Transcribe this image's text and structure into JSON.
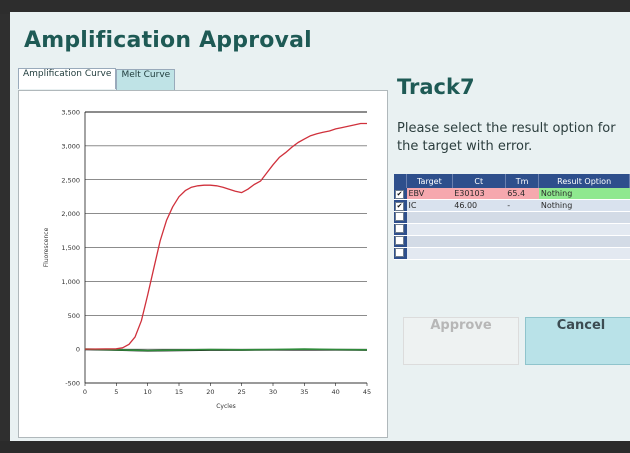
{
  "dialog": {
    "title": "Amplification Approval",
    "tabs": [
      {
        "label": "Amplification Curve",
        "active": true
      },
      {
        "label": "Melt Curve",
        "active": false
      }
    ],
    "track": "Track7",
    "prompt": "Please select the result option for the target with error.",
    "buttons": {
      "approve": "Approve",
      "cancel": "Cancel"
    }
  },
  "table": {
    "headers": [
      "Target",
      "Ct",
      "Tm",
      "Result Option"
    ],
    "rows": [
      {
        "checked": "✔",
        "target": "EBV",
        "ct": "E30103",
        "tm": "65.4",
        "option": "Nothing"
      },
      {
        "checked": "✔",
        "target": "IC",
        "ct": "46.00",
        "tm": "-",
        "option": "Nothing"
      }
    ],
    "empty_rows": 4
  },
  "colors": {
    "accent": "#1e5a55",
    "header": "#2e4f8c",
    "error_row": "#f6a8ae",
    "ok_cell": "#8fe88f",
    "curve_red": "#d0313c",
    "curve_green": "#2f8a3a"
  },
  "chart_data": {
    "type": "line",
    "ylabel": "Fluorescence",
    "xlabel": "Cycles",
    "xlim": [
      0,
      45
    ],
    "ylim": [
      -500,
      3500
    ],
    "xticks": [
      "0",
      "5",
      "10",
      "15",
      "20",
      "25",
      "30",
      "35",
      "40",
      "45"
    ],
    "yticks": [
      "-500",
      "0",
      "500",
      "1,000",
      "1,500",
      "2,000",
      "2,500",
      "3,000",
      "3,500"
    ],
    "series": [
      {
        "color": "#d0313c",
        "x": [
          0,
          5,
          6,
          7,
          8,
          9,
          10,
          11,
          12,
          13,
          14,
          15,
          16,
          17,
          18,
          19,
          20,
          21,
          22,
          23,
          24,
          25,
          26,
          27,
          28,
          29,
          30,
          31,
          32,
          33,
          34,
          35,
          36,
          37,
          38,
          39,
          40,
          41,
          42,
          43,
          44,
          45
        ],
        "y": [
          0,
          5,
          20,
          70,
          180,
          420,
          800,
          1200,
          1600,
          1900,
          2100,
          2250,
          2340,
          2390,
          2410,
          2420,
          2420,
          2410,
          2390,
          2360,
          2330,
          2310,
          2360,
          2430,
          2480,
          2600,
          2720,
          2830,
          2900,
          2980,
          3050,
          3100,
          3150,
          3180,
          3200,
          3220,
          3250,
          3270,
          3290,
          3310,
          3330,
          3330
        ]
      },
      {
        "color": "#2f8a3a",
        "x": [
          0,
          5,
          10,
          15,
          20,
          25,
          30,
          35,
          40,
          45
        ],
        "y": [
          0,
          -10,
          -20,
          -15,
          -5,
          -10,
          -5,
          0,
          -5,
          -10
        ]
      },
      {
        "color": "#1e1e1e",
        "x": [
          0,
          5,
          10,
          15,
          20,
          25,
          30,
          35,
          40,
          45
        ],
        "y": [
          -5,
          -15,
          -25,
          -20,
          -15,
          -15,
          -10,
          -10,
          -10,
          -15
        ]
      }
    ]
  }
}
